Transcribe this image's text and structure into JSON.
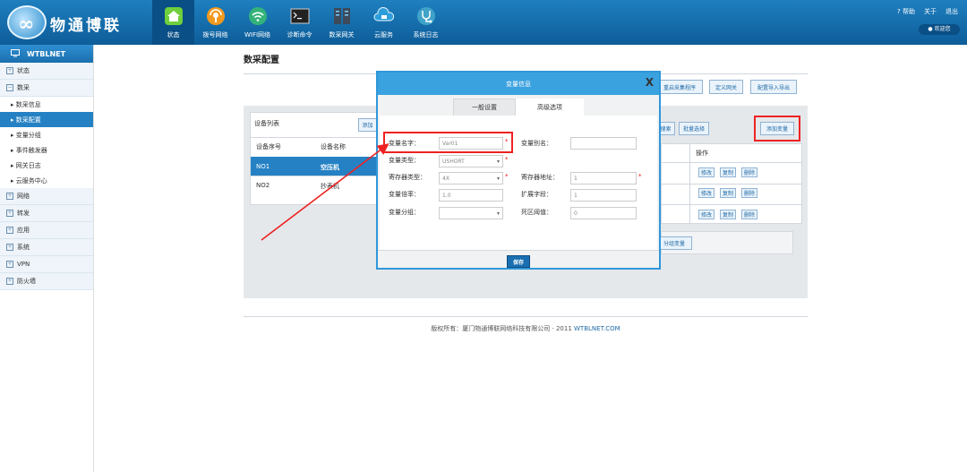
{
  "brand": {
    "logo_glyph": "∞",
    "name": "物通博联"
  },
  "nav": [
    {
      "label": "状态",
      "icon": "home-icon",
      "active": true
    },
    {
      "label": "拨号网络",
      "icon": "dialup-icon"
    },
    {
      "label": "WIFI网络",
      "icon": "wifi-icon"
    },
    {
      "label": "诊断命令",
      "icon": "terminal-icon"
    },
    {
      "label": "数采网关",
      "icon": "gateway-icon"
    },
    {
      "label": "云服务",
      "icon": "cloud-icon"
    },
    {
      "label": "系统日志",
      "icon": "stethoscope-icon"
    }
  ],
  "toplinks": {
    "help": "? 帮助",
    "about": "关于",
    "logout": "退出",
    "welcome": "欢迎您"
  },
  "sidebar": {
    "title": "WTBLNET",
    "groups": [
      {
        "label": "状态"
      },
      {
        "label": "数采"
      }
    ],
    "subs": [
      "数采信息",
      "数采配置",
      "变量分组",
      "事件触发器",
      "网关日志",
      "云服务中心"
    ],
    "groups2": [
      "网络",
      "转发",
      "应用",
      "系统",
      "VPN",
      "防火墙"
    ]
  },
  "page": {
    "title": "数采配置",
    "top_buttons": {
      "restart": "重启采集程序",
      "custom_gateway": "定义网关",
      "import_export": "配置导入导出"
    },
    "device_list": {
      "title": "设备列表",
      "add": "添加",
      "headers": [
        "设备序号",
        "设备名称"
      ],
      "rows": [
        {
          "no": "NO1",
          "name": "空压机"
        },
        {
          "no": "NO2",
          "name": "抄表机"
        }
      ]
    },
    "var_panel": {
      "search": "搜索",
      "batch": "批量选择",
      "add_var": "添加变量",
      "op_header": "操作",
      "ops": [
        "修改",
        "复制",
        "删除"
      ],
      "group_var": "分组变量"
    }
  },
  "modal": {
    "title": "变量信息",
    "close": "X",
    "tabs": [
      "一般设置",
      "高级选项"
    ],
    "fields": {
      "var_name_label": "变量名字：",
      "var_name_value": "Var01",
      "alias_label": "变量别名：",
      "alias_value": "",
      "type_label": "变量类型：",
      "type_value": "USHORT",
      "reg_type_label": "寄存器类型：",
      "reg_type_value": "4X",
      "reg_addr_label": "寄存器地址：",
      "reg_addr_value": "1",
      "ratio_label": "变量倍率：",
      "ratio_value": "1.0",
      "ext_label": "扩展字段：",
      "ext_value": "1",
      "group_label": "变量分组：",
      "group_value": "",
      "deadband_label": "死区阈值：",
      "deadband_value": "0"
    },
    "save": "保存"
  },
  "footer": {
    "text": "版权所有：厦门物通博联网络科技有限公司 · 2011 ",
    "link": "WTBLNET.COM"
  },
  "colors": {
    "accent": "#2581c4",
    "highlight": "#e22222",
    "header": "#3ba2e0"
  }
}
